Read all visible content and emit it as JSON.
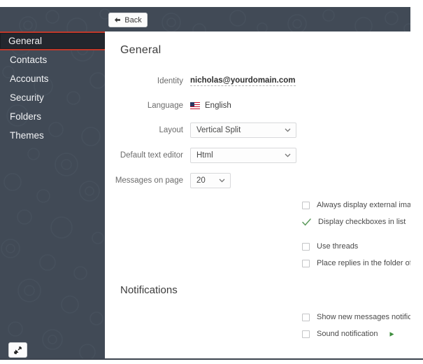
{
  "window": {
    "accent_red": "#c0392b",
    "chrome_dark": "#414a56",
    "panel_bg": "#ffffff",
    "check_green": "#5b9a5b"
  },
  "header": {
    "back_label": "Back",
    "back_icon": "arrow-left-icon"
  },
  "sidebar": {
    "items": [
      {
        "label": "General",
        "active": true
      },
      {
        "label": "Contacts",
        "active": false
      },
      {
        "label": "Accounts",
        "active": false
      },
      {
        "label": "Security",
        "active": false
      },
      {
        "label": "Folders",
        "active": false
      },
      {
        "label": "Themes",
        "active": false
      }
    ],
    "resize_icon": "resize-diagonal-icon"
  },
  "main": {
    "page_title": "General",
    "fields": [
      {
        "label": "Identity",
        "type": "text-static",
        "value": "nicholas@yourdomain.com"
      },
      {
        "label": "Language",
        "type": "flag-text",
        "value": "English",
        "flag": "us-flag-icon"
      },
      {
        "label": "Layout",
        "type": "select",
        "value": "Vertical Split"
      },
      {
        "label": "Default text editor",
        "type": "select",
        "value": "Html"
      },
      {
        "label": "Messages on page",
        "type": "select-narrow",
        "value": "20"
      }
    ],
    "checkboxes": [
      {
        "label": "Always display external images in message body",
        "checked": false
      },
      {
        "label": "Display checkboxes in list",
        "checked": true
      },
      {
        "label": "Use threads",
        "checked": false
      },
      {
        "label": "Place replies in the folder of the message being replied to",
        "checked": false
      }
    ],
    "notifications": {
      "title": "Notifications",
      "checkboxes": [
        {
          "label": "Show new messages notification popups",
          "checked": false,
          "play": false
        },
        {
          "label": "Sound notification",
          "checked": false,
          "play": true
        }
      ]
    }
  }
}
